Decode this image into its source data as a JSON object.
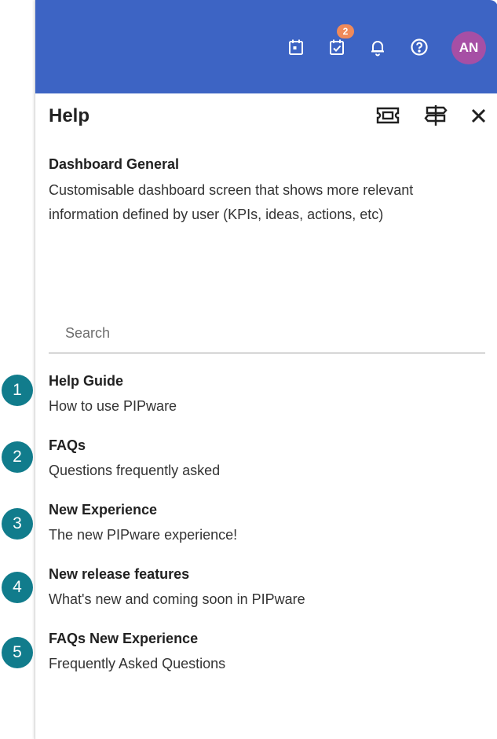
{
  "topbar": {
    "icons": [
      "calendar-icon",
      "task-check-icon",
      "bell-icon",
      "help-circle-icon"
    ],
    "tasks_badge": "2",
    "avatar_initials": "AN",
    "color": "#3d64c4",
    "avatar_color": "#a64fa5",
    "badge_color": "#f08a5a"
  },
  "panel": {
    "title": "Help",
    "header_icons": [
      "ticket-icon",
      "signpost-icon",
      "close-icon"
    ],
    "section": {
      "title": "Dashboard General",
      "description": "Customisable dashboard screen that shows more relevant information defined by user (KPIs, ideas, actions, etc)"
    },
    "search": {
      "placeholder": "Search",
      "value": ""
    },
    "items": [
      {
        "number": "1",
        "title": "Help Guide",
        "subtitle": "How to use PIPware"
      },
      {
        "number": "2",
        "title": "FAQs",
        "subtitle": "Questions frequently asked"
      },
      {
        "number": "3",
        "title": "New Experience",
        "subtitle": "The new PIPware experience!"
      },
      {
        "number": "4",
        "title": "New release features",
        "subtitle": "What's new and coming soon in PIPware"
      },
      {
        "number": "5",
        "title": "FAQs New Experience",
        "subtitle": "Frequently Asked Questions"
      }
    ],
    "marker_color": "#117c8c"
  }
}
